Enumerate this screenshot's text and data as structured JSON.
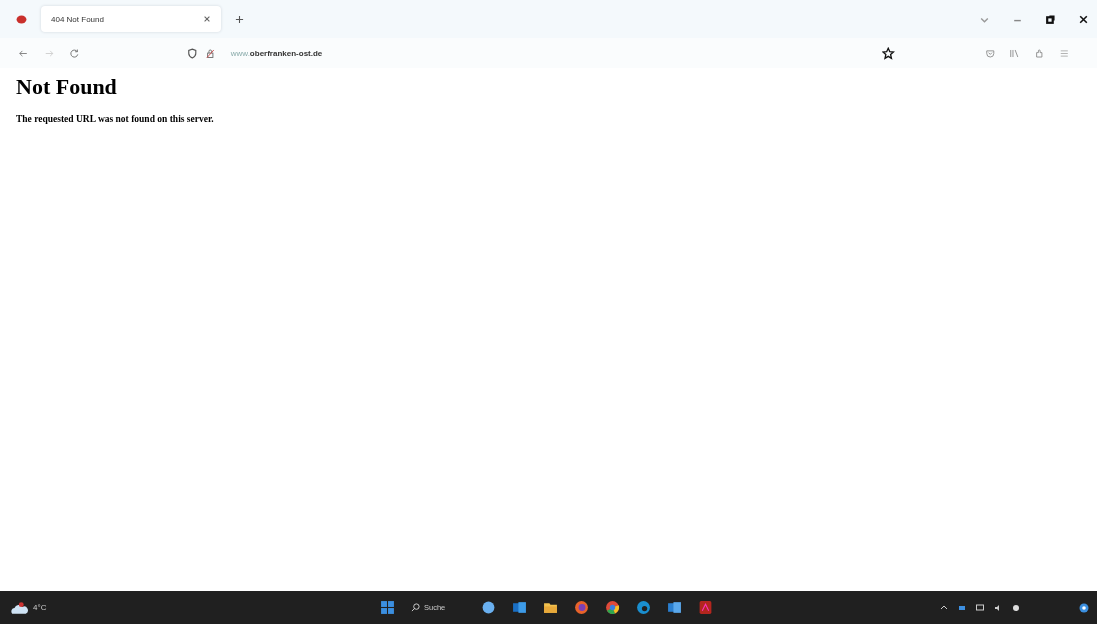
{
  "tabs": [
    {
      "title": "404 Not Found",
      "selected": true
    }
  ],
  "address_bar": {
    "prefix": "www.",
    "domain": "oberfranken-ost.de"
  },
  "page": {
    "heading": "Not Found",
    "message": "The requested URL was not found on this server."
  },
  "taskbar": {
    "weather": "4°C",
    "search_placeholder": "Suche"
  }
}
